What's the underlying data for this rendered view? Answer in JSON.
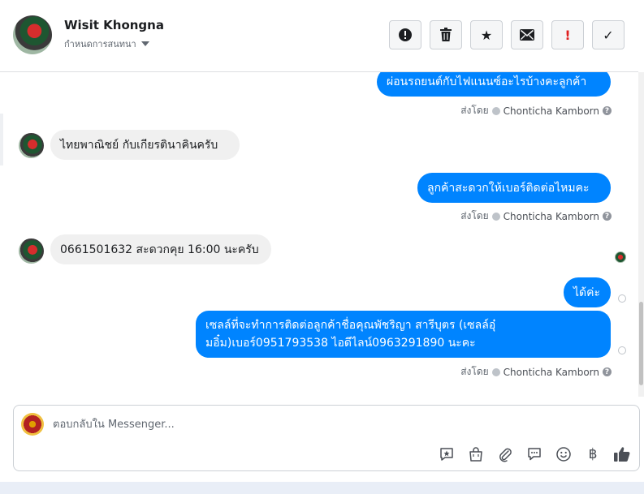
{
  "header": {
    "contact_name": "Wisit Khongna",
    "status_label": "กำหนดการสนทนา",
    "actions": [
      {
        "name": "report-spam-button",
        "icon": "alert-circle-icon",
        "glyph": "!"
      },
      {
        "name": "delete-button",
        "icon": "trash-icon",
        "glyph": ""
      },
      {
        "name": "star-button",
        "icon": "star-icon",
        "glyph": "★"
      },
      {
        "name": "mark-unread-button",
        "icon": "envelope-icon",
        "glyph": ""
      },
      {
        "name": "follow-up-button",
        "icon": "exclamation-icon",
        "glyph": "!"
      },
      {
        "name": "done-button",
        "icon": "checkmark-icon",
        "glyph": "✓"
      }
    ]
  },
  "messages": [
    {
      "direction": "out",
      "text": "ผ่อนรถยนต์กับไฟแนนซ์อะไรบ้างคะลูกค้า",
      "sent_by_label": "ส่งโดย",
      "author": "Chonticha Kamborn"
    },
    {
      "direction": "in",
      "text": "ไทยพาณิชย์ กับเกียรตินาคินครับ"
    },
    {
      "direction": "out",
      "text": "ลูกค้าสะดวกให้เบอร์ติดต่อไหมคะ",
      "sent_by_label": "ส่งโดย",
      "author": "Chonticha Kamborn"
    },
    {
      "direction": "in",
      "text": "0661501632 สะดวกคุย 16:00 นะครับ"
    },
    {
      "direction": "out",
      "text": "ได้ค่ะ"
    },
    {
      "direction": "out",
      "text_line1": "เซลล์ที่จะทำการติดต่อลูกค้าชื่อคุณพัชริญา สารีบุตร (เซลล์อุ๋",
      "text_line2": "มอิ๋ม)เบอร์0951793538 ไอดีไลน์0963291890 นะคะ",
      "sent_by_label": "ส่งโดย",
      "author": "Chonticha Kamborn"
    }
  ],
  "composer": {
    "placeholder": "ตอบกลับใน Messenger...",
    "tools": [
      "saved-reply-icon",
      "shopping-bag-icon",
      "attachment-icon",
      "chat-bubble-icon",
      "emoji-icon",
      "baht-icon",
      "thumbs-up-icon"
    ],
    "baht_glyph": "฿"
  },
  "colors": {
    "outgoing_bubble": "#0084ff",
    "incoming_bubble": "#f0f0f0",
    "flag_red": "#e02020"
  }
}
